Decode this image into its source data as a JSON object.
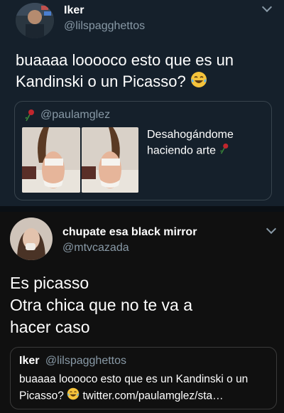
{
  "tweet1": {
    "name": "Iker",
    "handle": "@lilspagghettos",
    "text": "buaaaa looooco esto que es un Kandinski o un Picasso?",
    "emoji": "laughing-tears-emoji",
    "quote": {
      "handle": "@paulamglez",
      "text_line1": "Desahogándome",
      "text_line2": "haciendo arte",
      "emoji": "rose-emoji"
    }
  },
  "tweet2": {
    "name": "chupate esa black mirror",
    "handle": "@mtvcazada",
    "text_line1": "Es picasso",
    "text_line2": "Otra chica que no te va a",
    "text_line3": "hacer caso",
    "quote": {
      "name": "Iker",
      "handle": "@lilspagghettos",
      "text_line1": "buaaaa looooco esto que es un Kandinski o un",
      "text_line2_prefix": "Picasso?",
      "text_line2_suffix": "twitter.com/paulamglez/sta…"
    }
  },
  "colors": {
    "panel1_bg": "#15202b",
    "panel2_bg": "#101010",
    "text": "#ffffff",
    "secondary": "#8899a6"
  }
}
